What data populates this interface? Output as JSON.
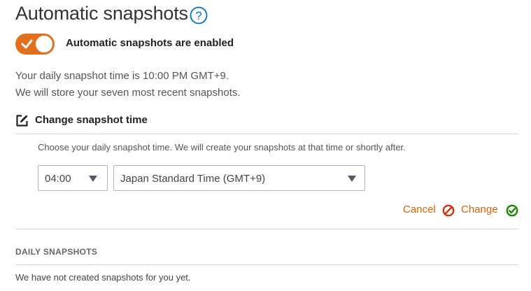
{
  "header": {
    "title": "Automatic snapshots",
    "help_icon": "help-circle-icon"
  },
  "toggle": {
    "state": "on",
    "label": "Automatic snapshots are enabled",
    "accent_color": "#e0701e"
  },
  "info": {
    "line1": "Your daily snapshot time is 10:00 PM GMT+9.",
    "line2": "We will store your seven most recent snapshots."
  },
  "change_time": {
    "icon": "edit-icon",
    "label": "Change snapshot time",
    "description": "Choose your daily snapshot time. We will create your snapshots at that time or shortly after.",
    "time_select": {
      "value": "04:00"
    },
    "zone_select": {
      "value": "Japan Standard Time (GMT+9)"
    },
    "cancel_label": "Cancel",
    "change_label": "Change",
    "cancel_color": "#d13212",
    "confirm_color": "#1d8102"
  },
  "daily": {
    "heading": "DAILY SNAPSHOTS",
    "empty_text": "We have not created snapshots for you yet."
  }
}
